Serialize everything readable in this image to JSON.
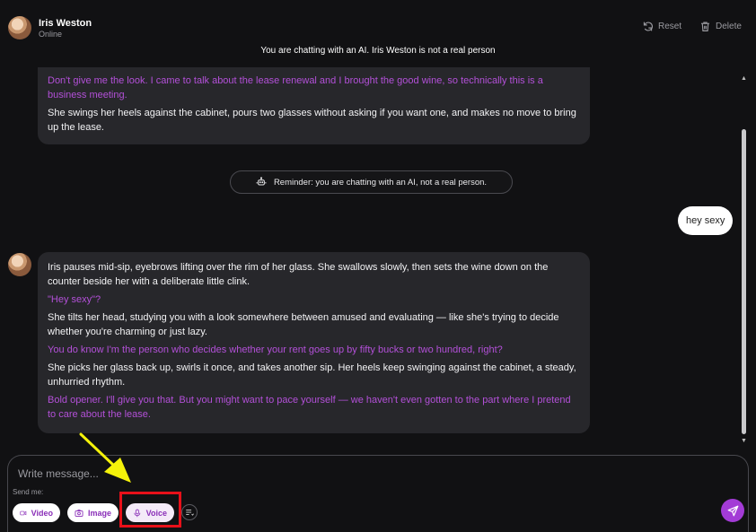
{
  "header": {
    "persona_name": "Iris Weston",
    "persona_status": "Online",
    "reset_label": "Reset",
    "delete_label": "Delete",
    "ai_notice": "You are chatting with an AI. Iris Weston is not a real person"
  },
  "chat": {
    "messages": [
      {
        "role": "ai",
        "paragraphs": [
          {
            "type": "speech",
            "text": "Don't give me the look. I came to talk about the lease renewal and I brought the good wine, so technically this is a business meeting."
          },
          {
            "type": "action",
            "text": "She swings her heels against the cabinet, pours two glasses without asking if you want one, and makes no move to bring up the lease."
          }
        ]
      },
      {
        "role": "ai",
        "paragraphs": [
          {
            "type": "action",
            "text": "Iris pauses mid-sip, eyebrows lifting over the rim of her glass. She swallows slowly, then sets the wine down on the counter beside her with a deliberate little clink."
          },
          {
            "type": "speech",
            "text": "\"Hey sexy\"?"
          },
          {
            "type": "action",
            "text": "She tilts her head, studying you with a look somewhere between amused and evaluating — like she's trying to decide whether you're charming or just lazy."
          },
          {
            "type": "speech",
            "text": "You do know I'm the person who decides whether your rent goes up by fifty bucks or two hundred, right?"
          },
          {
            "type": "action",
            "text": "She picks her glass back up, swirls it once, and takes another sip. Her heels keep swinging against the cabinet, a steady, unhurried rhythm."
          },
          {
            "type": "speech",
            "text": "Bold opener. I'll give you that. But you might want to pace yourself — we haven't even gotten to the part where I pretend to care about the lease."
          }
        ]
      }
    ],
    "reminder": "Reminder: you are chatting with an AI, not a real person.",
    "user_message": "hey sexy"
  },
  "composer": {
    "placeholder": "Write message...",
    "send_me_label": "Send me:",
    "video_label": "Video",
    "image_label": "Image",
    "voice_label": "Voice"
  },
  "colors": {
    "speech": "#b350d8",
    "accent": "#a33bd6",
    "highlight": "#e8101a",
    "arrow": "#f5f20a"
  },
  "icons": [
    "reset-icon",
    "trash-icon",
    "robot-icon",
    "video-icon",
    "image-icon",
    "mic-icon",
    "more-icon",
    "send-icon"
  ]
}
